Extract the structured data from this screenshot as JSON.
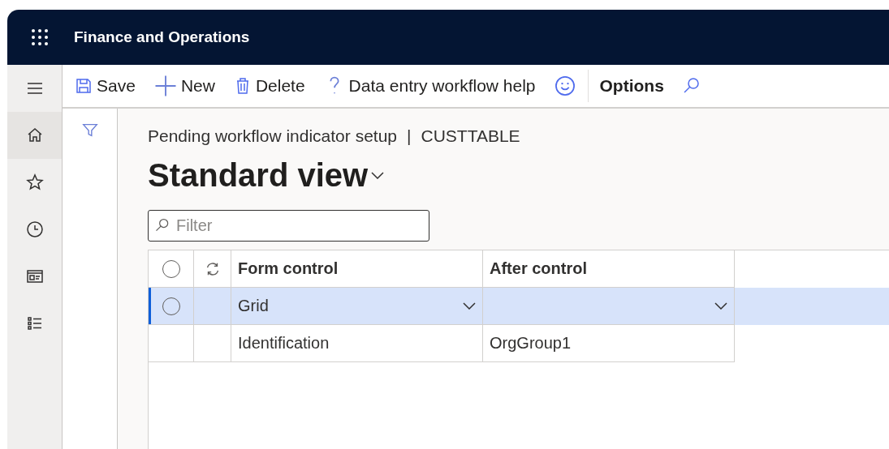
{
  "app": {
    "title": "Finance and Operations"
  },
  "toolbar": [
    {
      "kind": "save",
      "label": "Save"
    },
    {
      "kind": "new",
      "label": "New"
    },
    {
      "kind": "delete",
      "label": "Delete"
    },
    {
      "kind": "help",
      "label": "Data entry workflow help"
    },
    {
      "kind": "feedback"
    },
    {
      "kind": "options",
      "label": "Options"
    },
    {
      "kind": "search"
    }
  ],
  "nav": [
    {
      "kind": "home",
      "selected": true
    },
    {
      "kind": "favorites",
      "selected": false
    },
    {
      "kind": "recent",
      "selected": false
    },
    {
      "kind": "workspaces",
      "selected": false
    },
    {
      "kind": "modules",
      "selected": false
    }
  ],
  "page": {
    "caption": "Pending workflow indicator setup",
    "separator": "|",
    "company": "CUSTTABLE",
    "view": "Standard view",
    "filter": {
      "placeholder": "Filter"
    }
  },
  "grid": {
    "select_all": {
      "checked": false
    },
    "columns": [
      "Form control",
      "After control"
    ],
    "rows": [
      {
        "selected": true,
        "editing": true,
        "cells": [
          "Grid",
          ""
        ]
      },
      {
        "selected": false,
        "editing": false,
        "cells": [
          "Identification",
          "OrgGroup1"
        ]
      }
    ]
  }
}
